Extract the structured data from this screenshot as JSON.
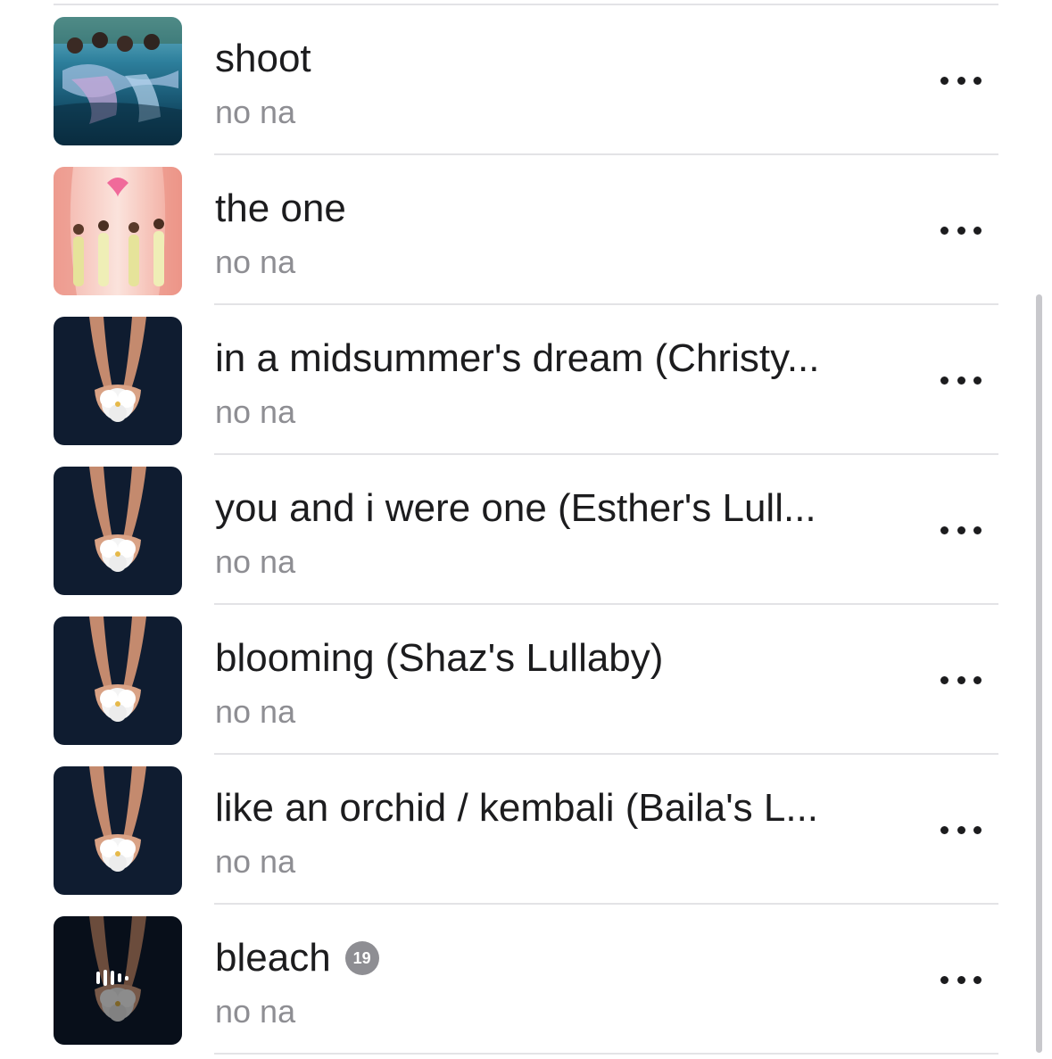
{
  "songs": [
    {
      "title": "shoot",
      "artist": "no na",
      "art": "pool-cover",
      "explicit": false,
      "playing": false
    },
    {
      "title": "the one",
      "artist": "no na",
      "art": "pink-curtain-cover",
      "explicit": false,
      "playing": false
    },
    {
      "title": "in a midsummer's dream (Christy...",
      "artist": "no na",
      "art": "orchid-hands-cover",
      "explicit": false,
      "playing": false
    },
    {
      "title": "you and i were one (Esther's Lull...",
      "artist": "no na",
      "art": "orchid-hands-cover",
      "explicit": false,
      "playing": false
    },
    {
      "title": "blooming (Shaz's Lullaby)",
      "artist": "no na",
      "art": "orchid-hands-cover",
      "explicit": false,
      "playing": false
    },
    {
      "title": "like an orchid / kembali (Baila's L...",
      "artist": "no na",
      "art": "orchid-hands-cover",
      "explicit": false,
      "playing": false
    },
    {
      "title": "bleach",
      "artist": "no na",
      "art": "orchid-hands-cover",
      "explicit": true,
      "badge": "19",
      "playing": true
    }
  ],
  "icons": {
    "more": "more-ellipsis-icon",
    "playing": "now-playing-waveform-icon",
    "explicit": "age-rating-badge"
  },
  "colors": {
    "text_primary": "#1c1c1e",
    "text_secondary": "#8e8e93",
    "divider": "#e3e3e6",
    "badge": "#8e8e93"
  }
}
